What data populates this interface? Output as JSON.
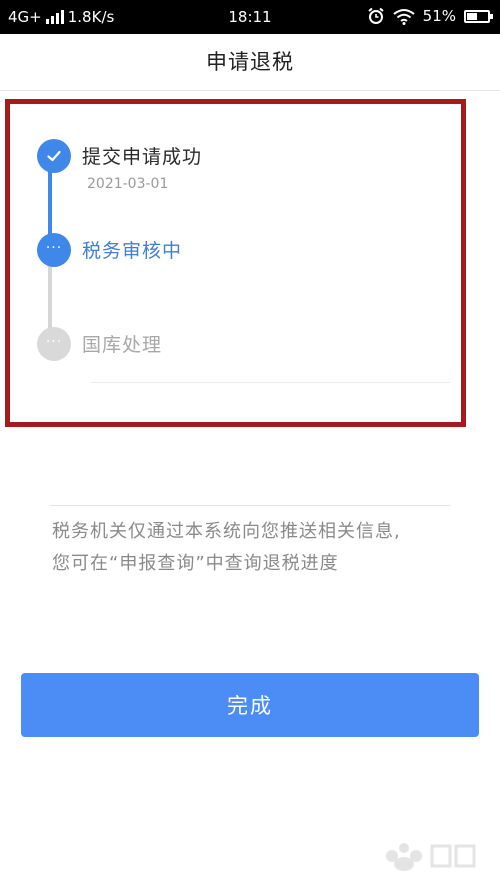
{
  "status_bar": {
    "network": "4G+",
    "speed": "1.8K/s",
    "time": "18:11",
    "battery": "51%",
    "battery_level": 0.51,
    "icons": [
      "alarm-icon",
      "wifi-icon",
      "battery-icon"
    ]
  },
  "header": {
    "title": "申请退税"
  },
  "timeline": {
    "steps": [
      {
        "label": "提交申请成功",
        "date": "2021-03-01",
        "state": "done",
        "icon": "check-icon"
      },
      {
        "label": "税务审核中",
        "state": "active",
        "icon": "ellipsis-icon"
      },
      {
        "label": "国库处理",
        "state": "pending",
        "icon": "ellipsis-icon"
      }
    ]
  },
  "info": {
    "text_line1": "税务机关仅通过本系统向您推送相关信息,",
    "text_line2": "您可在“申报查询”中查询退税进度"
  },
  "button": {
    "done_label": "完成"
  },
  "colors": {
    "accent": "#4b8cf5",
    "highlight_border": "#a61c1c",
    "pending": "#d9d9d9",
    "text_muted": "#8a8a8a"
  },
  "watermark": {
    "text": "Bai经验"
  }
}
